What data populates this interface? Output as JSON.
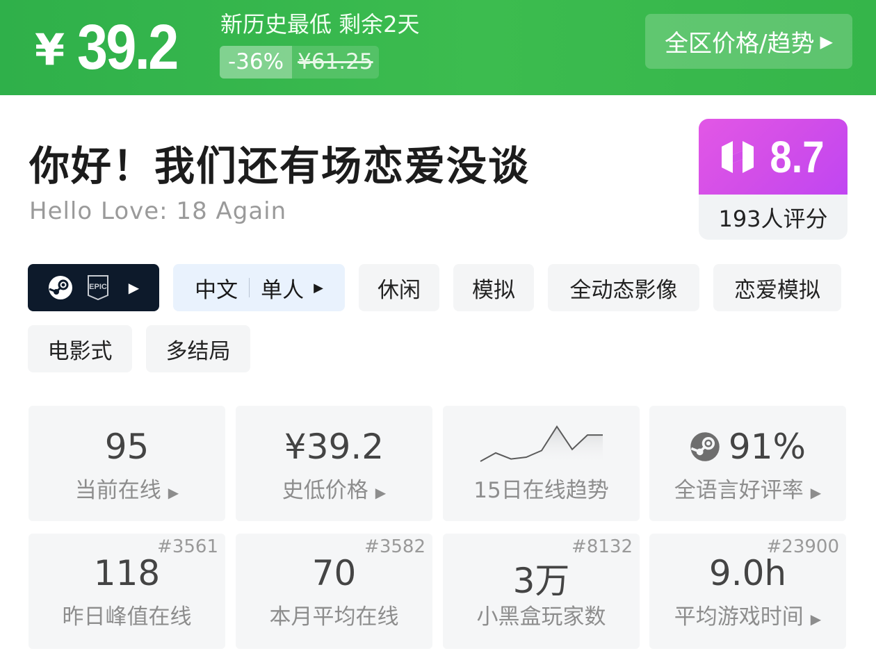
{
  "banner": {
    "currency": "¥",
    "price": "39.2",
    "deal_title": "新历史最低 剩余2天",
    "discount": "-36%",
    "original_price": "¥61.25",
    "region_button": "全区价格/趋势",
    "colors": {
      "background": "#3cbc4f"
    }
  },
  "game": {
    "title": "你好！我们还有场恋爱没谈",
    "subtitle": "Hello Love: 18 Again"
  },
  "score": {
    "value": "8.7",
    "raters": "193人评分",
    "icon": "heybox-logo-icon",
    "colors": {
      "gradient_start": "#e257e6",
      "gradient_end": "#c046f2"
    }
  },
  "tags": {
    "platform_icons": [
      "steam-icon",
      "epic-games-icon"
    ],
    "language": "中文",
    "mode": "单人",
    "items": [
      "休闲",
      "模拟",
      "全动态影像",
      "恋爱模拟",
      "电影式",
      "多结局"
    ]
  },
  "stats": {
    "online": {
      "value": "95",
      "label": "当前在线"
    },
    "lowest": {
      "value": "¥39.2",
      "label": "史低价格"
    },
    "trend": {
      "label": "15日在线趋势",
      "points": [
        0,
        14,
        4,
        7,
        18,
        58,
        20,
        44,
        44
      ]
    },
    "rating": {
      "value": "91%",
      "label": "全语言好评率"
    },
    "peak": {
      "value": "118",
      "label": "昨日峰值在线",
      "rank": "#3561"
    },
    "monthly": {
      "value": "70",
      "label": "本月平均在线",
      "rank": "#3582"
    },
    "players": {
      "value": "3万",
      "label": "小黑盒玩家数",
      "rank": "#8132"
    },
    "playtime": {
      "value": "9.0h",
      "label": "平均游戏时间",
      "rank": "#23900"
    }
  }
}
